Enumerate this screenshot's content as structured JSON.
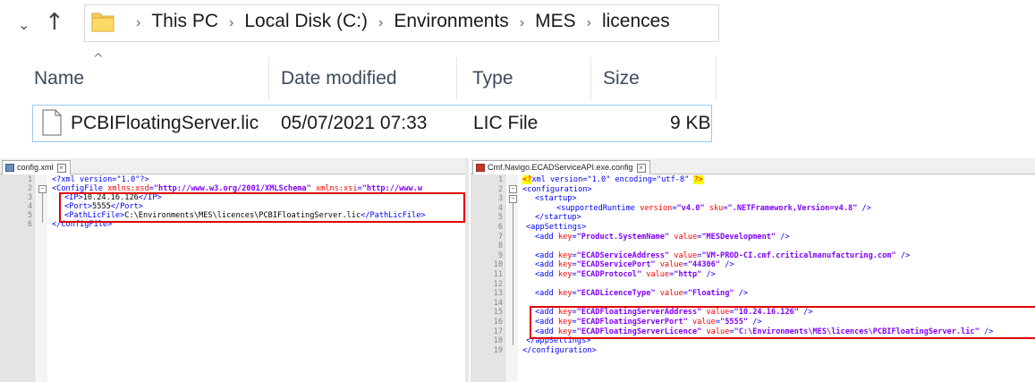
{
  "explorer": {
    "path": [
      "This PC",
      "Local Disk (C:)",
      "Environments",
      "MES",
      "licences"
    ],
    "separator": "›",
    "columns": {
      "name": "Name",
      "date": "Date modified",
      "type": "Type",
      "size": "Size"
    },
    "file": {
      "name": "PCBIFloatingServer.lic",
      "date": "05/07/2021 07:33",
      "type": "LIC File",
      "size": "9 KB"
    },
    "icons": [
      "chevron-down-icon",
      "up-arrow-icon",
      "folder-icon",
      "file-icon"
    ]
  },
  "left_editor": {
    "tab": "config.xml",
    "lines": [
      "1",
      "2",
      "3",
      "4",
      "5",
      "6"
    ],
    "code": {
      "l1": "<?xml version=\"1.0\"?>",
      "l2_open": "<ConfigFile ",
      "l2_a1": "xmlns:xsd",
      "l2_v1": "\"http://www.w3.org/2001/XMLSchema\"",
      "l2_a2": "xmlns:xsi",
      "l2_v2": "\"http://www.w",
      "l3_open": "<IP>",
      "l3_text": "10.24.16.126",
      "l3_close": "</IP>",
      "l4_open": "<Port>",
      "l4_text": "5555",
      "l4_close": "</Port>",
      "l5_open": "<PathLicFile>",
      "l5_text": "C:\\Environments\\MES\\licences\\PCBIFloatingServer.lic",
      "l5_close": "</PathLicFile>",
      "l6": "</ConfigFile>"
    }
  },
  "right_editor": {
    "tab": "Cmf.Navigo.ECADServiceAPI.exe.config",
    "lines": [
      "1",
      "2",
      "3",
      "4",
      "5",
      "6",
      "7",
      "8",
      "9",
      "10",
      "11",
      "12",
      "13",
      "14",
      "15",
      "16",
      "17",
      "18",
      "19"
    ],
    "code": {
      "l1_pi": "<?",
      "l1_rest": "xml version=\"1.0\" encoding=\"utf-8\" ",
      "l1_end": "?>",
      "l2": "<configuration>",
      "l3": "<startup>",
      "l4_open": "<supportedRuntime ",
      "l4_a1": "version",
      "l4_v1": "\"v4.0\"",
      "l4_a2": "sku",
      "l4_v2": "\".NETFramework,Version=v4.8\"",
      "l4_close": " />",
      "l5": "</startup>",
      "l6": "<appSettings>",
      "l7": {
        "key": "\"Product.SystemName\"",
        "value": "\"MESDevelopment\""
      },
      "l9": {
        "key": "\"ECADServiceAddress\"",
        "value": "\"VM-PROD-CI.cmf.criticalmanufacturing.com\""
      },
      "l10": {
        "key": "\"ECADServicePort\"",
        "value": "\"44306\""
      },
      "l11": {
        "key": "\"ECADProtocol\"",
        "value": "\"http\""
      },
      "l13": {
        "key": "\"ECADLicenceType\"",
        "value": "\"Floating\""
      },
      "l15": {
        "key": "\"ECADFloatingServerAddress\"",
        "value": "\"10.24.16.126\""
      },
      "l16": {
        "key": "\"ECADFloatingServerPort\"",
        "value": "\"5555\""
      },
      "l17": {
        "key": "\"ECADFloatingServerLicence\"",
        "value": "\"C:\\Environments\\MES\\licences\\PCBIFloatingServer.lic\""
      },
      "l18": "</appSettings>",
      "l19": "</configuration>",
      "add_open": "<add ",
      "key_attr": "key",
      "value_attr": "value",
      "eq": "=",
      "close": " />"
    }
  },
  "colors": {
    "highlight_box": "#e00000",
    "tag": "#0000ff",
    "attribute": "#ff0000",
    "value": "#8000ff"
  }
}
